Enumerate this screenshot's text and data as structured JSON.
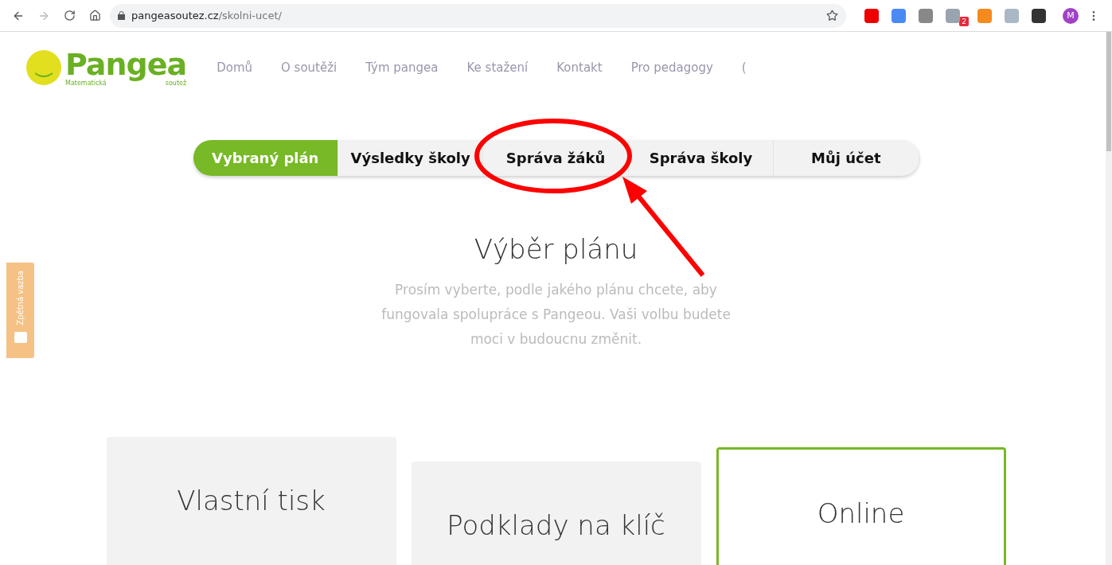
{
  "browser": {
    "url_host": "pangeasoutez.cz",
    "url_path": "/skolni-ucet/",
    "extension_badge": "2",
    "profile_initial": "M"
  },
  "logo": {
    "name": "Pangea",
    "tagline_left": "Matematická",
    "tagline_right": "soutež"
  },
  "nav": [
    {
      "label": "Domů"
    },
    {
      "label": "O soutěži"
    },
    {
      "label": "Tým pangea"
    },
    {
      "label": "Ke stažení"
    },
    {
      "label": "Kontakt"
    },
    {
      "label": "Pro pedagogy"
    },
    {
      "label": "("
    }
  ],
  "tabs": [
    {
      "label": "Vybraný plán",
      "selected": true
    },
    {
      "label": "Výsledky školy",
      "selected": false
    },
    {
      "label": "Správa žáků",
      "selected": false
    },
    {
      "label": "Správa školy",
      "selected": false
    },
    {
      "label": "Můj účet",
      "selected": false
    }
  ],
  "heading": "Výběr plánu",
  "intro": "Prosím vyberte, podle jakého plánu chcete, aby fungovala spolupráce s Pangeou. Vaši volbu budete moci v budoucnu změnit.",
  "feedback": {
    "label": "Zpětná vazba"
  },
  "plans": [
    {
      "title": "Vlastní tisk",
      "selected": false
    },
    {
      "title": "Podklady na klíč",
      "selected": false
    },
    {
      "title": "Online",
      "selected": true
    }
  ]
}
